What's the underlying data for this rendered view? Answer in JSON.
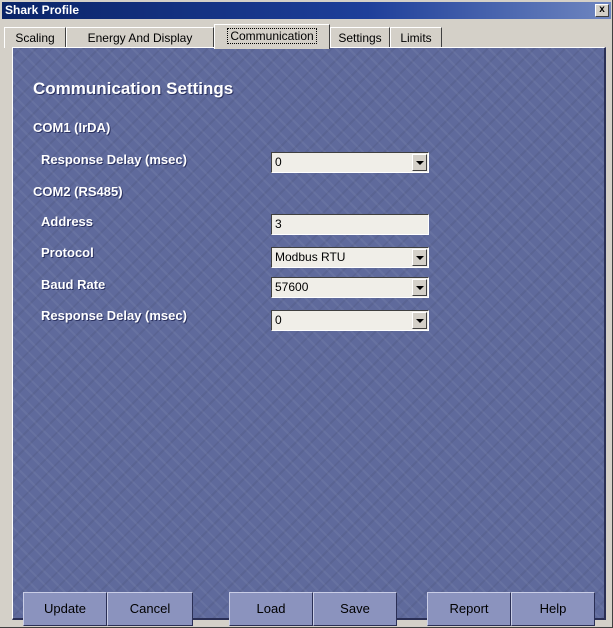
{
  "window": {
    "title": "Shark Profile",
    "close_glyph": "x"
  },
  "tabs": [
    {
      "label": "Scaling",
      "active": false
    },
    {
      "label": "Energy And Display",
      "active": false
    },
    {
      "label": "Communication",
      "active": true
    },
    {
      "label": "Settings",
      "active": false
    },
    {
      "label": "Limits",
      "active": false
    }
  ],
  "panel": {
    "heading": "Communication Settings",
    "com1": {
      "label": "COM1 (IrDA)",
      "response_delay": {
        "label": "Response Delay (msec)",
        "value": "0"
      }
    },
    "com2": {
      "label": "COM2 (RS485)",
      "address": {
        "label": "Address",
        "value": "3"
      },
      "protocol": {
        "label": "Protocol",
        "value": "Modbus RTU"
      },
      "baud_rate": {
        "label": "Baud Rate",
        "value": "57600"
      },
      "response_delay": {
        "label": "Response Delay (msec)",
        "value": "0"
      }
    }
  },
  "buttons": {
    "update": "Update",
    "cancel": "Cancel",
    "load": "Load",
    "save": "Save",
    "report": "Report",
    "help": "Help"
  },
  "colors": {
    "title_bar": "#0a2468",
    "panel_background": "#5f6a9c",
    "button_face": "#8b93be"
  }
}
